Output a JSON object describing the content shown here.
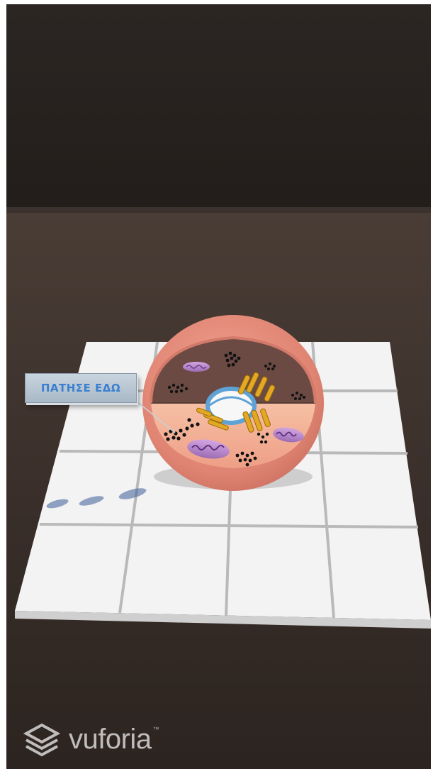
{
  "ar_overlay": {
    "button_label": "ΠΑΤΗΣΕ ΕΔΩ"
  },
  "watermark": {
    "brand": "vuforia",
    "trademark": "™"
  },
  "colors": {
    "table": "#3a302b",
    "grid_tile": "#f4f4f4",
    "cell_shell": "#e38a78",
    "cell_inner": "#f2b299",
    "cytoplasm": "#6b4a44",
    "organelle_golgi": "#e0a020",
    "organelle_mito": "#b084c4",
    "button_text": "#3a7fd0"
  }
}
